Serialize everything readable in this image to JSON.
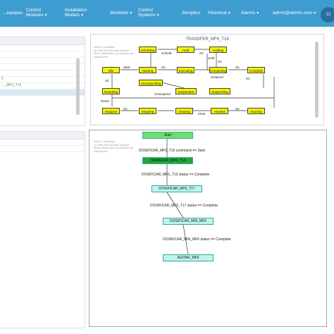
{
  "nav": {
    "items": [
      {
        "label": "...equipes"
      },
      {
        "label": "Control\nModules"
      },
      {
        "label": "Installation\nModels"
      },
      {
        "label": "Worklists"
      },
      {
        "label": "Control\nSystems"
      },
      {
        "label": "Sinoptics"
      },
      {
        "label": "Historical"
      },
      {
        "label": "Alarms"
      },
      {
        "label": "admin@admin.com"
      }
    ],
    "user_button": "CI"
  },
  "left_panel": {
    "rows": [
      "",
      "",
      "",
      "",
      "",
      "0",
      "..._MF6_T16",
      "",
      "",
      ""
    ]
  },
  "state_panel": {
    "title": "TRANSFER_MF6_T16",
    "watermark": "Draft 1.0 evaluation\n(c) 1998-2016 Aeroinfo Software\nNot for distribution or production use\nnoaedio.com",
    "states": [
      "Unholding",
      "Hold",
      "Holding",
      "Idle",
      "Starting",
      "Executing",
      "Completing",
      "Complete",
      "Resetting",
      "Unsuspending",
      "Suspended",
      "Suspending",
      "Stopped",
      "Stopping",
      "Clearing",
      "Aborted",
      "Aborting"
    ],
    "edge_labels": [
      "Unhold",
      "SC",
      "Start",
      "SC",
      "Hold",
      "SC",
      "SC",
      "Suspend",
      "SC",
      "SC",
      "Unsuspend",
      "Reset",
      "SC",
      "Clear",
      "SC"
    ]
  },
  "flow_panel": {
    "watermark": "Draft 1.0 evaluation\n(c) 1998-2016 Aeroinfo Software\nNot for distribution or production use\nnoaedio.com",
    "nodes": [
      "Start",
      "TRANSFER_MF6_T16",
      "DOSIFICAR_MF6_T17",
      "DOSIFICAR_MIN_MF6",
      "AGITAR_MF6"
    ],
    "conditions": [
      "DOSIFICAR_MF6_T16 command == Start",
      "DOSIFICAR_MF6_T16 status == Complete",
      "DOSIFICAR_MF6_T17 status == Complete",
      "DOSIFICAR_MIN_MF6 status == Complete"
    ]
  },
  "colors": {
    "header": "#3f9cd0",
    "state_fill": "#f4f400",
    "flow_start": "#6fdc6f",
    "flow_active": "#27a33a",
    "flow_step": "#bff4ee"
  }
}
